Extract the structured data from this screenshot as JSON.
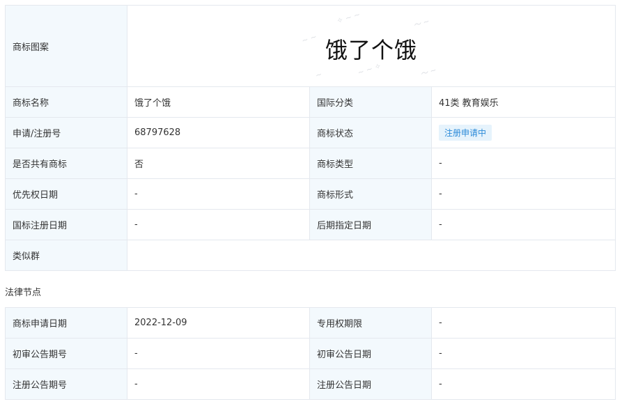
{
  "trademark": {
    "image_label": "商标图案",
    "image_text": "饿了个饿",
    "name_label": "商标名称",
    "name_value": "饿了个饿",
    "intl_class_label": "国际分类",
    "intl_class_value": "41类 教育娱乐",
    "reg_no_label": "申请/注册号",
    "reg_no_value": "68797628",
    "status_label": "商标状态",
    "status_value": "注册申请中",
    "shared_label": "是否共有商标",
    "shared_value": "否",
    "type_label": "商标类型",
    "type_value": "-",
    "priority_label": "优先权日期",
    "priority_value": "-",
    "form_label": "商标形式",
    "form_value": "-",
    "intl_reg_date_label": "国标注册日期",
    "intl_reg_date_value": "-",
    "later_designation_label": "后期指定日期",
    "later_designation_value": "-",
    "similar_group_label": "类似群",
    "similar_group_value": ""
  },
  "legal": {
    "section_title": "法律节点",
    "apply_date_label": "商标申请日期",
    "apply_date_value": "2022-12-09",
    "exclusive_term_label": "专用权期限",
    "exclusive_term_value": "-",
    "prelim_issue_no_label": "初审公告期号",
    "prelim_issue_no_value": "-",
    "prelim_date_label": "初审公告日期",
    "prelim_date_value": "-",
    "reg_issue_no_label": "注册公告期号",
    "reg_issue_no_value": "-",
    "reg_date_label": "注册公告日期",
    "reg_date_value": "-"
  },
  "colors": {
    "label_bg": "#f3f9fd",
    "border": "#e4e8ee",
    "badge_bg": "#e6f3fc",
    "badge_text": "#2b8ad8"
  }
}
